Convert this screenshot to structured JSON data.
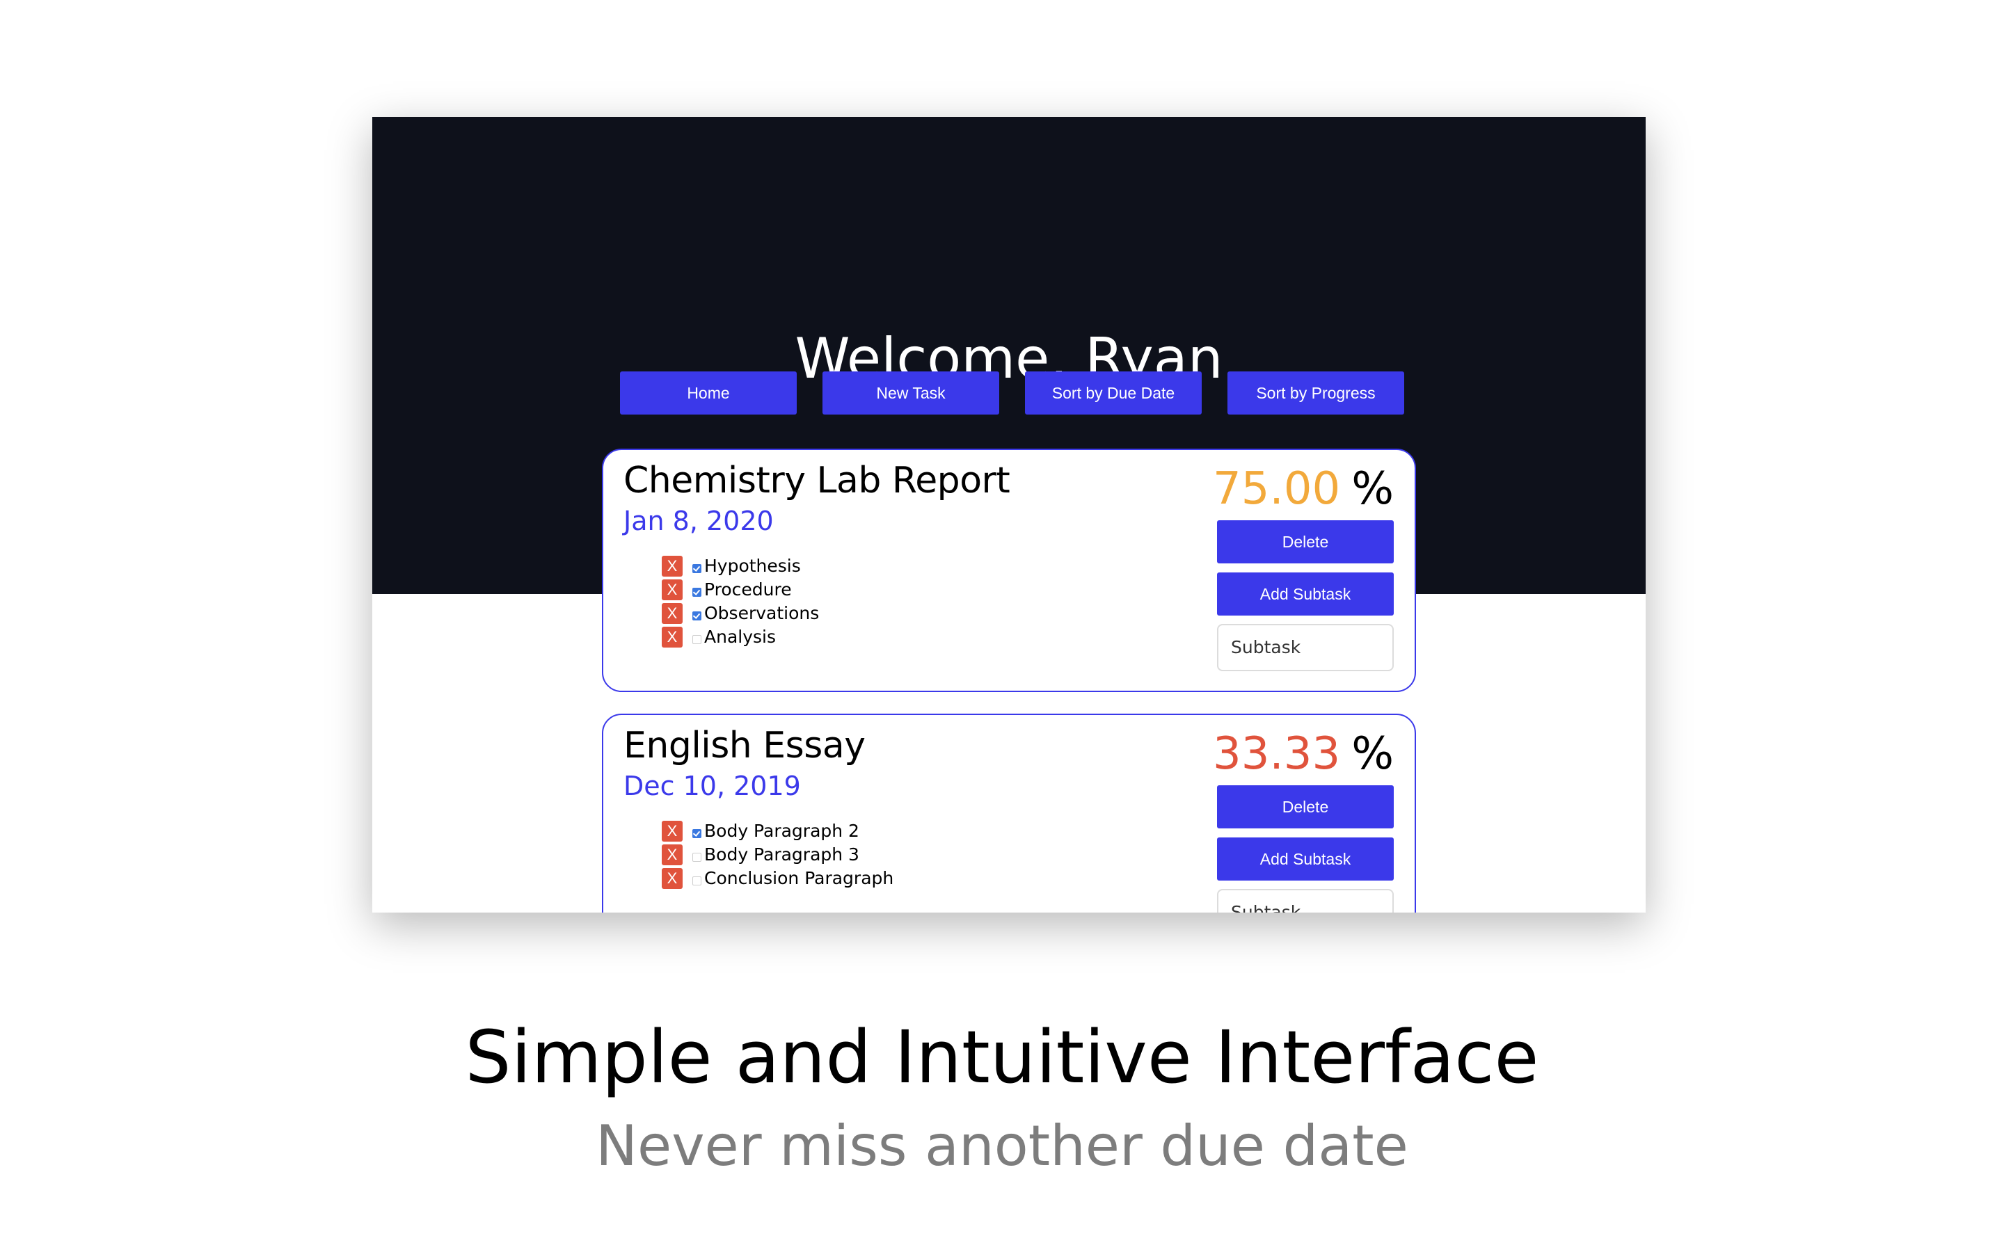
{
  "header": {
    "welcome_text": "Welcome, Ryan"
  },
  "nav": {
    "items": [
      {
        "label": "Home"
      },
      {
        "label": "New Task"
      },
      {
        "label": "Sort by Due Date"
      },
      {
        "label": "Sort by Progress"
      }
    ]
  },
  "tasks": [
    {
      "title": "Chemistry Lab Report",
      "due_date": "Jan 8, 2020",
      "progress": "75.00",
      "progress_unit": "%",
      "progress_color": "#f2a93b",
      "delete_label": "Delete",
      "add_subtask_label": "Add Subtask",
      "subtask_placeholder": "Subtask",
      "subtasks": [
        {
          "delete_label": "X",
          "label": "Hypothesis",
          "done": true
        },
        {
          "delete_label": "X",
          "label": "Procedure",
          "done": true
        },
        {
          "delete_label": "X",
          "label": "Observations",
          "done": true
        },
        {
          "delete_label": "X",
          "label": "Analysis",
          "done": false
        }
      ]
    },
    {
      "title": "English Essay",
      "due_date": "Dec 10, 2019",
      "progress": "33.33",
      "progress_unit": "%",
      "progress_color": "#e0533c",
      "delete_label": "Delete",
      "add_subtask_label": "Add Subtask",
      "subtask_placeholder": "Subtask",
      "subtasks": [
        {
          "delete_label": "X",
          "label": "Body Paragraph 2",
          "done": true
        },
        {
          "delete_label": "X",
          "label": "Body Paragraph 3",
          "done": false
        },
        {
          "delete_label": "X",
          "label": "Conclusion Paragraph",
          "done": false
        }
      ]
    }
  ],
  "caption": {
    "title": "Simple and Intuitive Interface",
    "subtitle": "Never miss another due date"
  },
  "colors": {
    "header_bg": "#0e111b",
    "accent": "#3b39ea",
    "delete_x": "#e0533c"
  }
}
